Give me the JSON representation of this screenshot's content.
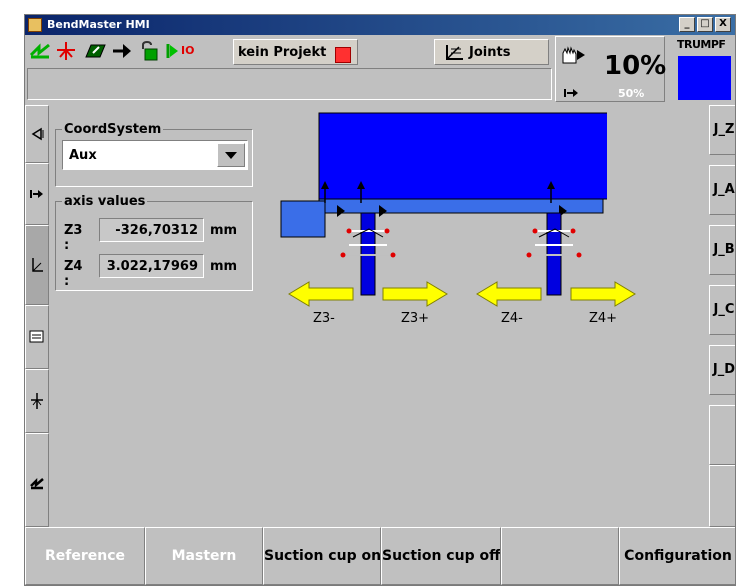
{
  "window": {
    "title": "BendMaster HMI",
    "minimize": "_",
    "maximize": "□",
    "close": "X"
  },
  "toolbar": {
    "icons": [
      "green-bend-icon",
      "red-tool-icon",
      "parallelogram-icon",
      "arrow-right-icon",
      "lock-open-icon",
      "io-icon"
    ],
    "io_label": "IO",
    "project_label": "kein Projekt",
    "joints_label": "Joints"
  },
  "speed": {
    "override": "10%",
    "setting": "50%",
    "hand_icon": "hand-icon",
    "arrow_icon": "arrow-right-icon"
  },
  "brand": {
    "label": "TRUMPF",
    "color": "#0000ff"
  },
  "left_nav": [
    "collapse-icon",
    "arrow-right-icon",
    "axes-icon",
    "panel-icon",
    "cursor-icon",
    "bend-icon"
  ],
  "coord": {
    "group_title": "CoordSystem",
    "selected": "Aux"
  },
  "axis_values": {
    "group_title": "axis values",
    "rows": [
      {
        "name": "Z3 :",
        "value": "-326,70312",
        "unit": "mm"
      },
      {
        "name": "Z4 :",
        "value": "3.022,17969",
        "unit": "mm"
      }
    ]
  },
  "diagram": {
    "labels": [
      "Z3-",
      "Z3+",
      "Z4-",
      "Z4+"
    ]
  },
  "right_nav": [
    "J_Z",
    "J_A",
    "J_B",
    "J_C",
    "J_D"
  ],
  "bottom": [
    {
      "label": "Reference",
      "enabled": false
    },
    {
      "label": "Mastern",
      "enabled": false
    },
    {
      "label": "Suction cup on",
      "enabled": true
    },
    {
      "label": "Suction cup off",
      "enabled": true
    },
    {
      "label": "",
      "enabled": false
    },
    {
      "label": "Configuration",
      "enabled": true
    }
  ]
}
